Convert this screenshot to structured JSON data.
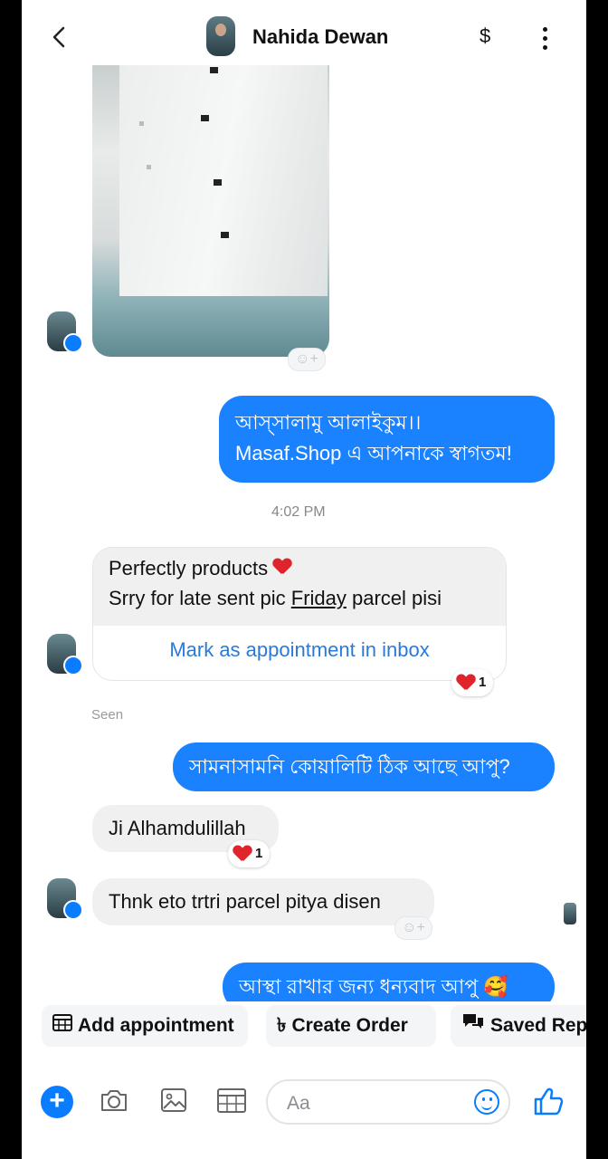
{
  "header": {
    "contact_name": "Nahida Dewan",
    "payment_glyph": "$",
    "back_icon": "chevron-left-icon",
    "menu_icon": "kebab-menu-icon"
  },
  "messages": {
    "greeting_line1": "আস্সালামু আলাইকুম।।",
    "greeting_line2": "Masaf.Shop এ আপনাকে স্বাগতম!",
    "timestamp": "4:02 PM",
    "card_line1": "Perfectly products",
    "card_line2_prefix": "Srry for late sent pic ",
    "card_line2_link": "Friday",
    "card_line2_suffix": " parcel pisi",
    "card_action": "Mark as appointment in inbox",
    "card_reaction_count": "1",
    "seen_label": "Seen",
    "out_quality": "সামনাসামনি কোয়ালিটি ঠিক আছে আপু?",
    "in_alhamdulillah": "Ji Alhamdulillah",
    "alhamdulillah_reaction_count": "1",
    "in_thanks": "Thnk eto trtri parcel pitya disen",
    "out_trust": "আস্থা রাখার জন্য ধন্যবাদ আপু 🥰",
    "add_reaction_glyph": "☺+"
  },
  "quick_replies": [
    {
      "label": "Add appointment",
      "icon": "calendar-icon"
    },
    {
      "label": "Create Order",
      "icon": "taka-icon"
    },
    {
      "label": "Saved Rep",
      "icon": "chat-bubbles-icon"
    }
  ],
  "composer": {
    "placeholder": "Aa",
    "plus_glyph": "+"
  },
  "colors": {
    "accent": "#0a7cff",
    "outgoing_bubble": "#1a82ff",
    "incoming_bubble": "#f0f0f1",
    "link": "#2a7ad6",
    "heart": "#e0242c"
  }
}
